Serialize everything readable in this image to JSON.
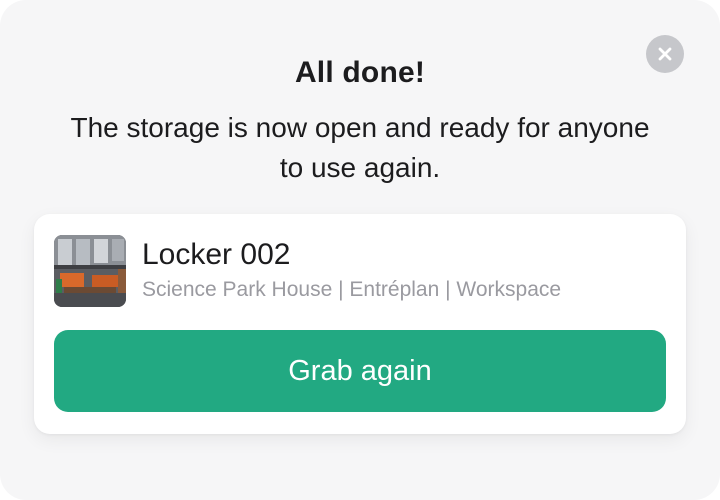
{
  "dialog": {
    "title": "All done!",
    "message": "The storage is now open and ready for anyone to use again.",
    "close_icon": "close-icon"
  },
  "locker": {
    "name": "Locker 002",
    "location": "Science Park House | Entréplan | Workspace",
    "image": "office-photo"
  },
  "actions": {
    "grab_label": "Grab again"
  },
  "colors": {
    "accent": "#22a982",
    "modal_bg": "#f6f6f7",
    "close_bg": "#c6c7cb"
  }
}
